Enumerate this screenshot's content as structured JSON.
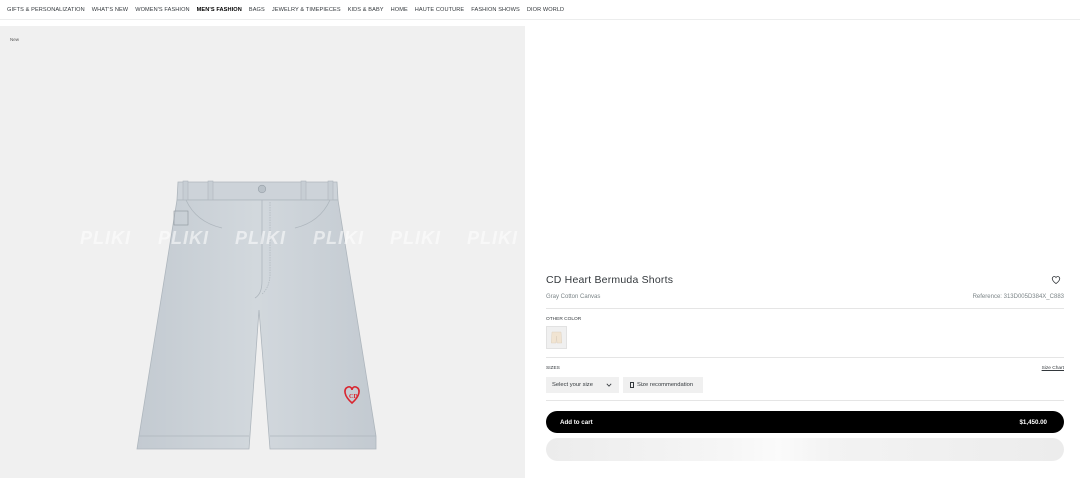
{
  "nav": {
    "items": [
      {
        "label": "GIFTS & PERSONALIZATION",
        "active": false
      },
      {
        "label": "WHAT'S NEW",
        "active": false
      },
      {
        "label": "WOMEN'S FASHION",
        "active": false
      },
      {
        "label": "MEN'S FASHION",
        "active": true
      },
      {
        "label": "BAGS",
        "active": false
      },
      {
        "label": "JEWELRY & TIMEPIECES",
        "active": false
      },
      {
        "label": "KIDS & BABY",
        "active": false
      },
      {
        "label": "HOME",
        "active": false
      },
      {
        "label": "HAUTE COUTURE",
        "active": false
      },
      {
        "label": "FASHION SHOWS",
        "active": false
      },
      {
        "label": "DIOR WORLD",
        "active": false
      }
    ]
  },
  "gallery": {
    "badge": "New",
    "watermark": "PLIKI",
    "shorts_color": "#c9d0d6",
    "logo_color": "#d9252f"
  },
  "product": {
    "title": "CD Heart Bermuda Shorts",
    "subtitle": "Gray Cotton Canvas",
    "reference": "Reference: 313D005D384X_C883",
    "other_color_label": "OTHER COLOR",
    "sizes_label": "SIZES",
    "size_chart": "Size Chart",
    "size_placeholder": "Select your size",
    "size_recommendation": "Size recommendation",
    "add_to_cart": "Add to cart",
    "price": "$1,450.00"
  }
}
